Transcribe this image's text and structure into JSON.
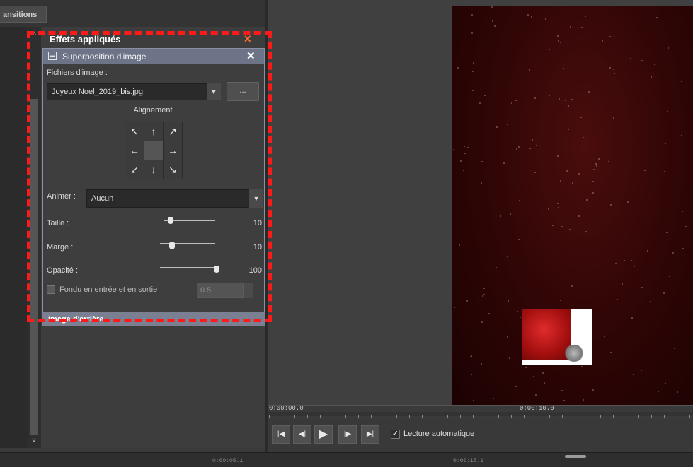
{
  "tabs": {
    "transitions_label": "ansitions"
  },
  "effects_panel": {
    "header": "Effets appliqués",
    "effect": {
      "title": "Superposition d'image",
      "files_label": "Fichiers d'image :",
      "file_value": "Joyeux Noel_2019_bis.jpg",
      "browse_label": "...",
      "alignment_label": "Alignement",
      "alignment_buttons": [
        "↖",
        "↑",
        "↗",
        "←",
        "",
        "→",
        "↙",
        "↓",
        "↘"
      ],
      "animate_label": "Animer :",
      "animate_value": "Aucun",
      "size_label": "Taille :",
      "size_value": "10",
      "size_level": 0.12,
      "margin_label": "Marge :",
      "margin_value": "10",
      "margin_level": 0.22,
      "opacity_label": "Opacité :",
      "opacity_value": "100",
      "opacity_level": 1.0,
      "fade_label": "Fondu en entrée et en sortie",
      "fade_value": "0.5",
      "fade_checked": false
    },
    "next_effect_label": "Image d'arrière"
  },
  "preview": {
    "time_start": "0:00:00.0",
    "time_mid": "0:00:10.0"
  },
  "transport": {
    "buttons": [
      "skip-back",
      "step-back",
      "play",
      "step-forward",
      "skip-forward"
    ],
    "autoplay_label": "Lecture automatique",
    "autoplay_checked": true
  },
  "bottom": {
    "time_a": "0:00:05.1",
    "time_b": "0:00:15.1"
  },
  "colors": {
    "annotation": "#ff1a1a",
    "close_accent": "#ff6a2a",
    "title_bar": "#6e7488"
  }
}
